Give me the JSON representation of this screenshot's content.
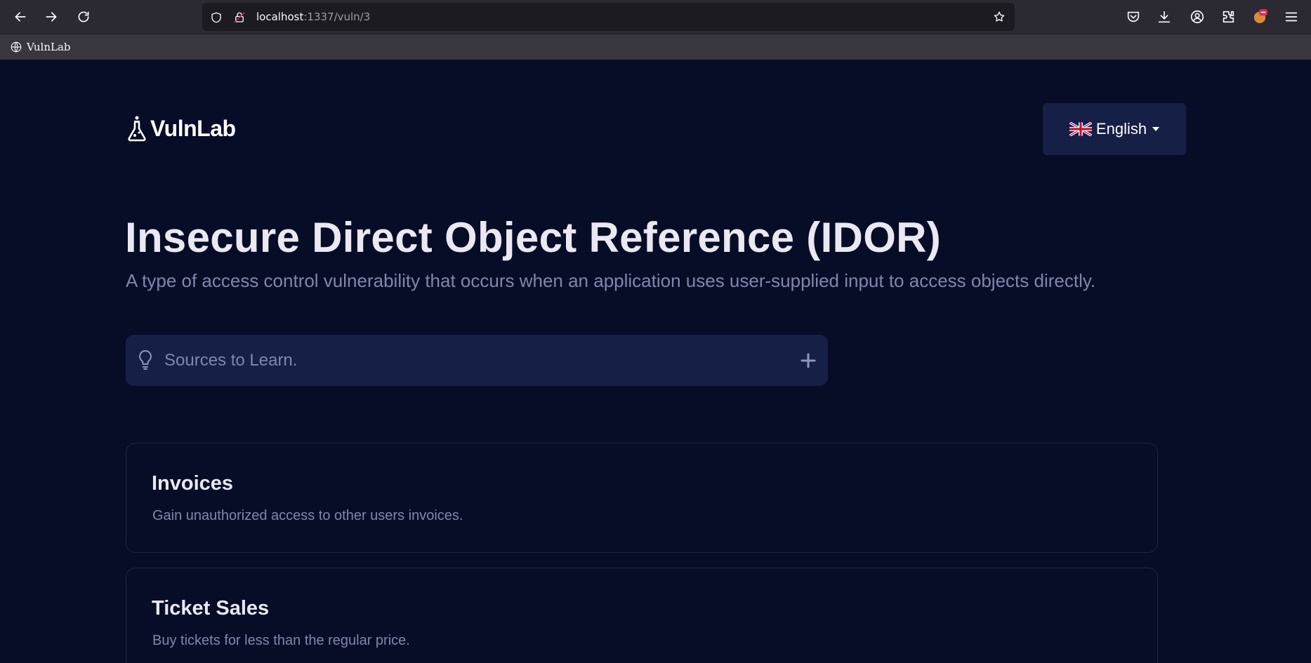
{
  "browser": {
    "url_host": "localhost",
    "url_path": ":1337/vuln/3",
    "bookmark_label": "VulnLab"
  },
  "header": {
    "logo_text": "VulnLab",
    "language_label": "English"
  },
  "main": {
    "title": "Insecure Direct Object Reference (IDOR)",
    "subtitle": "A type of access control vulnerability that occurs when an application uses user-supplied input to access objects directly.",
    "sources_label": "Sources to Learn."
  },
  "cards": [
    {
      "title": "Invoices",
      "description": "Gain unauthorized access to other users invoices."
    },
    {
      "title": "Ticket Sales",
      "description": "Buy tickets for less than the regular price."
    }
  ],
  "colors": {
    "page_bg": "#070d26",
    "panel_bg": "#162046",
    "heading": "#e9e8f3",
    "muted": "#7f87ac"
  }
}
